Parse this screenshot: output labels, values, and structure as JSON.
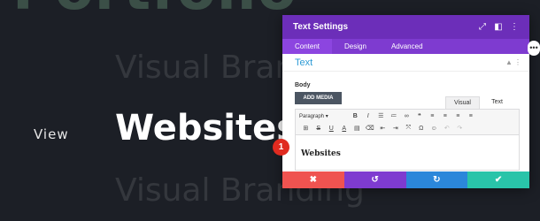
{
  "background": {
    "top_text": "Portfolio",
    "line1": "Visual Branding",
    "line2": "Visual Branding",
    "view_label": "View",
    "main_word": "Websites"
  },
  "panel": {
    "title": "Text Settings",
    "header_icons": [
      "expand-icon",
      "sidebar-icon",
      "more-vertical-icon"
    ],
    "tabs": [
      "Content",
      "Design",
      "Advanced"
    ],
    "active_tab": "Content",
    "section_title": "Text",
    "body_label": "Body",
    "add_media": "ADD MEDIA",
    "editor_tabs": [
      "Visual",
      "Text"
    ],
    "paragraph_select": "Paragraph",
    "editor_content": "Websites"
  },
  "badge_number": "1",
  "colors": {
    "panel_header": "#6c2eb9",
    "panel_tabs": "#7e3bd0",
    "section_title": "#2e9bd6",
    "cancel": "#ef5350",
    "undo": "#7e3bd0",
    "redo": "#2b87da",
    "save": "#29c4a9",
    "badge": "#e02b20"
  }
}
